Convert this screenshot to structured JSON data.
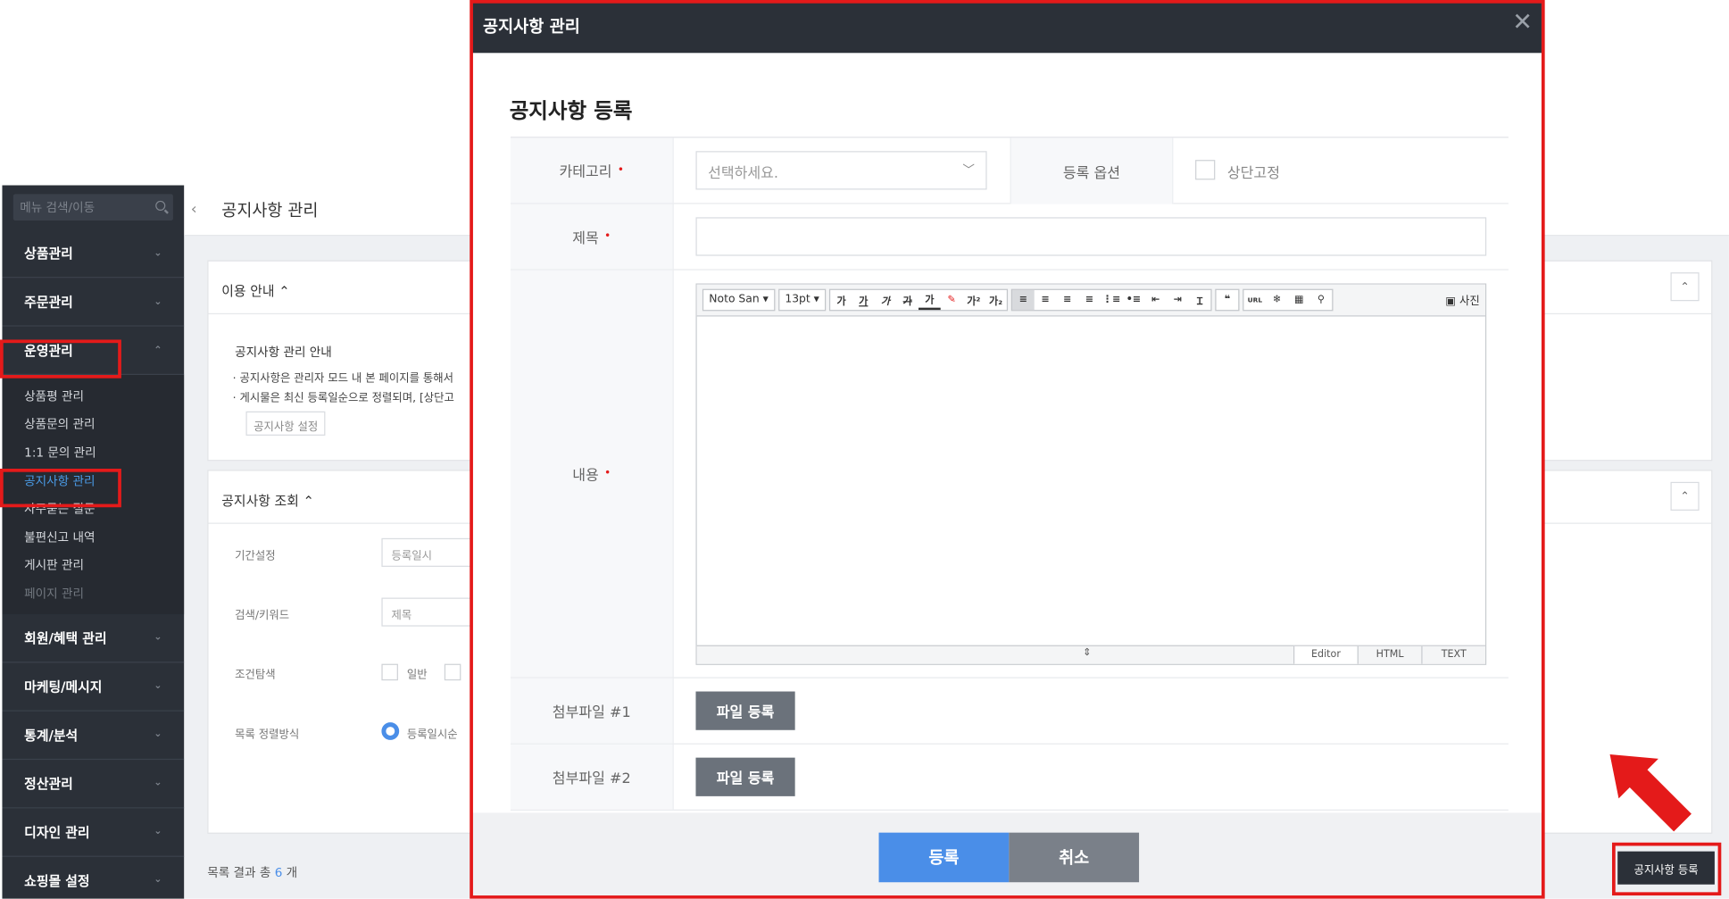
{
  "sidebar": {
    "search_placeholder": "메뉴 검색/이동",
    "menu_top": [
      "상품관리",
      "주문관리"
    ],
    "active_menu": "운영관리",
    "submenu": [
      "상품평 관리",
      "상품문의 관리",
      "1:1 문의 관리",
      "공지사항 관리",
      "자주묻는 질문",
      "불편신고 내역",
      "게시판 관리",
      "페이지 관리"
    ],
    "menu_bottom": [
      "회원/혜택 관리",
      "마케팅/메시지",
      "통계/분석",
      "정산관리",
      "디자인 관리",
      "쇼핑몰 설정"
    ]
  },
  "main": {
    "title": "공지사항 관리",
    "guide_title": "이용 안내 ⌃",
    "guide_heading": "공지사항 관리 안내",
    "guide_lines": [
      "· 공지사항은 관리자 모드 내 본 페이지를 통해서",
      "· 게시물은 최신 등록일순으로 정렬되며, [상단고"
    ],
    "guide_button": "공지사항 설정",
    "search_title": "공지사항 조회 ⌃",
    "period_label": "기간설정",
    "period_value": "등록일시",
    "keyword_label": "검색/키워드",
    "keyword_value": "제목",
    "condition_label": "조건탐색",
    "condition_option": "일반",
    "sort_label": "목록 정렬방식",
    "sort_option": "등록일시순",
    "result_prefix": "목록 결과 총",
    "result_count": "6",
    "result_suffix": "개",
    "register_button": "공지사항 등록"
  },
  "modal": {
    "header": "공지사항 관리",
    "close": "✕",
    "title": "공지사항 등록",
    "category_label": "카테고리",
    "category_placeholder": "선택하세요.",
    "option_label": "등록 옵션",
    "pin_label": "상단고정",
    "subject_label": "제목",
    "content_label": "내용",
    "required_mark": "•",
    "editor": {
      "font": "Noto San",
      "size": "13pt",
      "photo": "사진",
      "tabs": [
        "Editor",
        "HTML",
        "TEXT"
      ]
    },
    "attach1_label": "첨부파일 #1",
    "attach2_label": "첨부파일 #2",
    "file_button": "파일 등록",
    "submit": "등록",
    "cancel": "취소"
  },
  "colors": {
    "highlight": "#e41a1a",
    "primary": "#4a8ee8",
    "dark": "#2b3038"
  }
}
